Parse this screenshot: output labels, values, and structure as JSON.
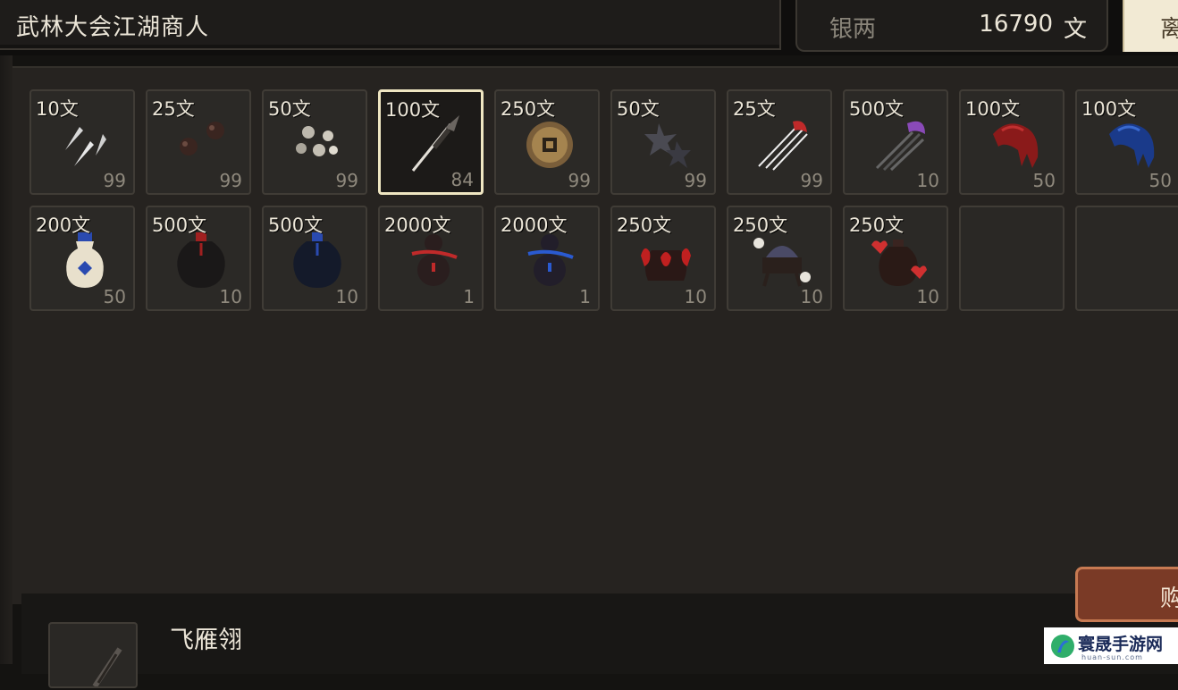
{
  "header": {
    "title": "武林大会江湖商人",
    "money_label": "银两",
    "money_value": "16790",
    "money_unit": "文",
    "leave_label": "离"
  },
  "shop": {
    "items": [
      {
        "price": "10文",
        "qty": "99",
        "icon": "throwing-darts-icon"
      },
      {
        "price": "25文",
        "qty": "99",
        "icon": "iron-balls-icon"
      },
      {
        "price": "50文",
        "qty": "99",
        "icon": "pebbles-icon"
      },
      {
        "price": "100文",
        "qty": "84",
        "icon": "feather-dart-icon"
      },
      {
        "price": "250文",
        "qty": "99",
        "icon": "coin-icon"
      },
      {
        "price": "50文",
        "qty": "99",
        "icon": "shuriken-icon"
      },
      {
        "price": "25文",
        "qty": "99",
        "icon": "red-needles-icon"
      },
      {
        "price": "500文",
        "qty": "10",
        "icon": "purple-needles-icon"
      },
      {
        "price": "100文",
        "qty": "50",
        "icon": "red-claw-icon"
      },
      {
        "price": "100文",
        "qty": "50",
        "icon": "blue-claw-icon"
      },
      {
        "price": "200文",
        "qty": "50",
        "icon": "porcelain-bottle-icon"
      },
      {
        "price": "500文",
        "qty": "10",
        "icon": "black-jar-red-icon"
      },
      {
        "price": "500文",
        "qty": "10",
        "icon": "black-jar-blue-icon"
      },
      {
        "price": "2000文",
        "qty": "1",
        "icon": "gourd-red-icon"
      },
      {
        "price": "2000文",
        "qty": "1",
        "icon": "gourd-blue-icon"
      },
      {
        "price": "250文",
        "qty": "10",
        "icon": "flame-pot-icon"
      },
      {
        "price": "250文",
        "qty": "10",
        "icon": "skull-cauldron-icon"
      },
      {
        "price": "250文",
        "qty": "10",
        "icon": "heart-jar-icon"
      },
      {
        "price": "",
        "qty": "",
        "icon": ""
      },
      {
        "price": "",
        "qty": "",
        "icon": ""
      }
    ],
    "selected_index": 3
  },
  "detail": {
    "name": "飞雁翎"
  },
  "buy_label": "购",
  "watermark": {
    "text": "寰晟手游网",
    "sub": "huan-sun.com"
  }
}
